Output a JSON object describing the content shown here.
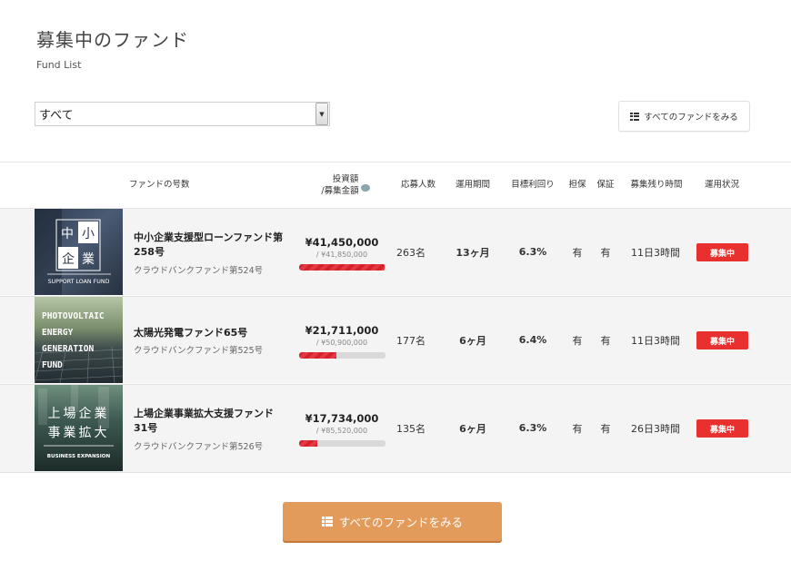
{
  "page": {
    "title": "募集中のファンド",
    "subtitle": "Fund List"
  },
  "filter": {
    "selected": "すべて"
  },
  "top_button": {
    "label": "すべてのファンドをみる",
    "icon": "list-icon"
  },
  "table": {
    "headers": {
      "name": "ファンドの号数",
      "amount_line1": "投資額",
      "amount_line2": "/募集金額",
      "applicants": "応募人数",
      "period": "運用期間",
      "yield": "目標利回り",
      "collateral": "担保",
      "guarantee": "保証",
      "remaining": "募集残り時間",
      "status": "運用状況"
    },
    "rows": [
      {
        "thumb_text": [
          "中",
          "小",
          "企",
          "業"
        ],
        "thumb_caption": "SUPPORT LOAN FUND",
        "name": "中小企業支援型ローンファンド第258号",
        "code": "クラウドバンクファンド第524号",
        "amount": "¥41,450,000",
        "target": "/ ¥41,850,000",
        "progress": 0.99,
        "applicants": "263名",
        "period": "13ヶ月",
        "yield": "6.3%",
        "collateral": "有",
        "guarantee": "有",
        "remaining": "11日3時間",
        "status": "募集中"
      },
      {
        "thumb_text": [
          "PHOTOVOLTAIC",
          "ENERGY",
          "GENERATION",
          "FUND"
        ],
        "thumb_caption": "",
        "name": "太陽光発電ファンド65号",
        "code": "クラウドバンクファンド第525号",
        "amount": "¥21,711,000",
        "target": "/ ¥50,900,000",
        "progress": 0.43,
        "applicants": "177名",
        "period": "6ヶ月",
        "yield": "6.4%",
        "collateral": "有",
        "guarantee": "有",
        "remaining": "11日3時間",
        "status": "募集中"
      },
      {
        "thumb_text": [
          "上場企業",
          "事業拡大"
        ],
        "thumb_caption": "BUSINESS EXPANSION",
        "name": "上場企業事業拡大支援ファンド31号",
        "code": "クラウドバンクファンド第526号",
        "amount": "¥17,734,000",
        "target": "/ ¥85,520,000",
        "progress": 0.21,
        "applicants": "135名",
        "period": "6ヶ月",
        "yield": "6.3%",
        "collateral": "有",
        "guarantee": "有",
        "remaining": "26日3時間",
        "status": "募集中"
      }
    ]
  },
  "bottom_button": {
    "label": "すべてのファンドをみる",
    "icon": "list-icon"
  },
  "colors": {
    "status_red": "#e8302f",
    "progress_red": "#d6202a",
    "cta_orange": "#e39b5b"
  }
}
